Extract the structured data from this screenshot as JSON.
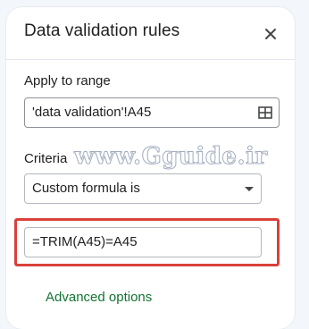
{
  "panel": {
    "title": "Data validation rules",
    "close_icon": "close-icon"
  },
  "apply_to_range": {
    "label": "Apply to range",
    "value": "'data validation'!A45",
    "icon": "select-range-grid-icon"
  },
  "watermark": {
    "text": "www.Gguide.ir"
  },
  "criteria": {
    "label": "Criteria",
    "selected": "Custom formula is",
    "formula": "=TRIM(A45)=A45"
  },
  "advanced_options": {
    "label": "Advanced options"
  },
  "colors": {
    "highlight_border": "#d9413a",
    "link_green": "#137333",
    "background": "#f3f6fb"
  }
}
